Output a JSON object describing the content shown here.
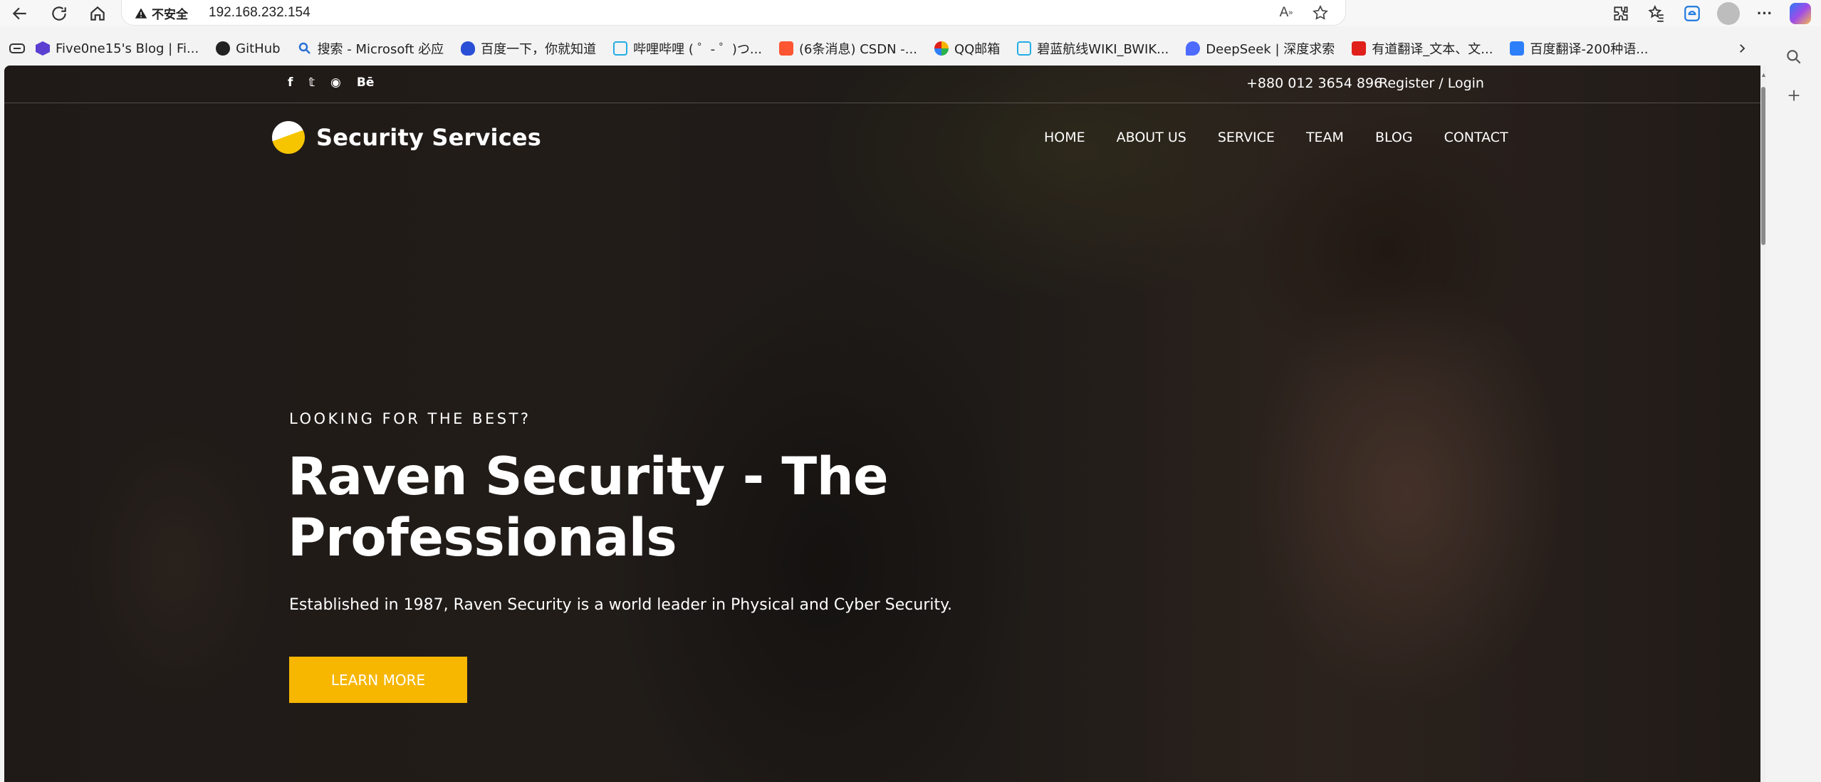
{
  "browser": {
    "security_label": "不安全",
    "url": "192.168.232.154",
    "bookmarks": [
      {
        "label": "Five0ne15's Blog | Fi...",
        "color": "#5b3fd1"
      },
      {
        "label": "GitHub",
        "color": "#222222"
      },
      {
        "label": "搜索 - Microsoft 必应",
        "color": "#2a6fd6"
      },
      {
        "label": "百度一下，你就知道",
        "color": "#2a4fd6"
      },
      {
        "label": "哔哩哔哩 ( ゜- ゜)つ...",
        "color": "#23ade5"
      },
      {
        "label": "(6条消息) CSDN -...",
        "color": "#fc5531"
      },
      {
        "label": "QQ邮箱",
        "color": "#f6b400"
      },
      {
        "label": "碧蓝航线WIKI_BWIK...",
        "color": "#23ade5"
      },
      {
        "label": "DeepSeek | 深度求索",
        "color": "#4d6bfe"
      },
      {
        "label": "有道翻译_文本、文...",
        "color": "#e0201b"
      },
      {
        "label": "百度翻译-200种语...",
        "color": "#2d7ff9"
      }
    ]
  },
  "site": {
    "social": [
      "f",
      "𝕥",
      "◉",
      "Bē"
    ],
    "phone": "+880 012 3654 896",
    "register_login": "Register / Login",
    "logo_text": "Security Services",
    "nav": [
      "HOME",
      "ABOUT US",
      "SERVICE",
      "TEAM",
      "BLOG",
      "CONTACT"
    ],
    "hero": {
      "eyebrow": "LOOKING FOR THE BEST?",
      "headline_line1": "Raven Security - The",
      "headline_line2": "Professionals",
      "subtitle": "Established in 1987, Raven Security is a world leader in Physical and Cyber Security.",
      "cta": "LEARN MORE"
    }
  },
  "colors": {
    "accent": "#f7b600"
  }
}
